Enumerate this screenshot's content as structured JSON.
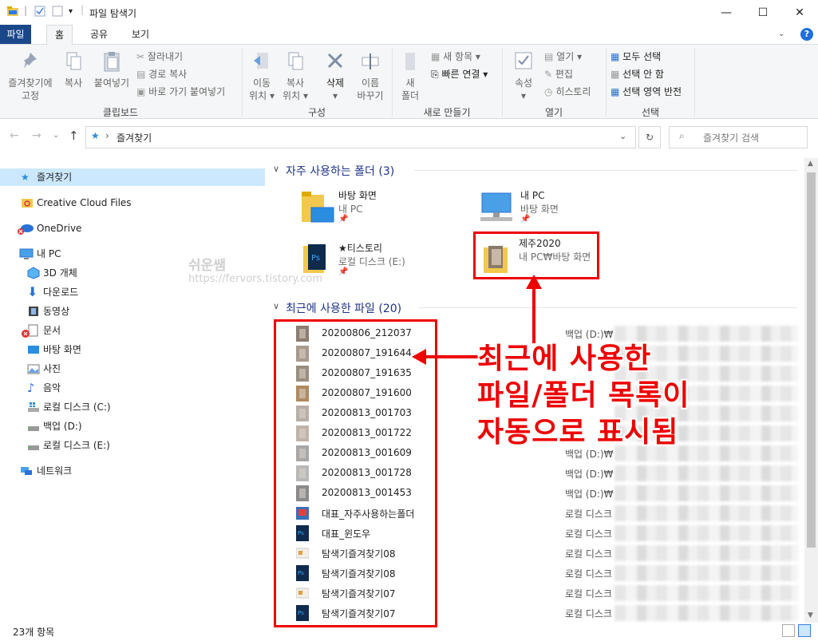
{
  "window": {
    "title": "파일 탐색기",
    "minimize": "—",
    "maximize": "☐",
    "close": "✕"
  },
  "tabs": [
    "파일",
    "홈",
    "공유",
    "보기"
  ],
  "help": "?",
  "ribbon": {
    "clipboard": {
      "label": "클립보드",
      "pin_line1": "즐겨찾기에",
      "pin_line2": "고정",
      "copy": "복사",
      "paste": "붙여넣기",
      "cut": "잘라내기",
      "copy_path": "경로 복사",
      "paste_shortcut": "바로 가기 붙여넣기"
    },
    "organize": {
      "label": "구성",
      "move_line1": "이동",
      "move_line2": "위치",
      "copyto_line1": "복사",
      "copyto_line2": "위치",
      "delete": "삭제",
      "rename_line1": "이름",
      "rename_line2": "바꾸기"
    },
    "new": {
      "label": "새로 만들기",
      "new_folder_line1": "새",
      "new_folder_line2": "폴더",
      "new_item": "새 항목",
      "easy_access": "빠른 연결"
    },
    "open": {
      "label": "열기",
      "properties": "속성",
      "open": "열기",
      "edit": "편집",
      "history": "히스토리"
    },
    "select": {
      "label": "선택",
      "select_all": "모두 선택",
      "select_none": "선택 안 함",
      "invert": "선택 영역 반전"
    }
  },
  "address": {
    "path": "즐겨찾기",
    "search_placeholder": "즐겨찾기 검색"
  },
  "nav": {
    "quick_access": "즐겨찾기",
    "creative_cloud": "Creative Cloud Files",
    "onedrive": "OneDrive",
    "this_pc": "내 PC",
    "objects3d": "3D 개체",
    "downloads": "다운로드",
    "videos": "동영상",
    "documents": "문서",
    "desktop": "바탕 화면",
    "pictures": "사진",
    "music": "음악",
    "drive_c": "로컬 디스크 (C:)",
    "drive_d": "백업 (D:)",
    "drive_e": "로컬 디스크 (E:)",
    "network": "네트워크"
  },
  "frequent": {
    "header": "자주 사용하는 폴더 (3)",
    "items": [
      {
        "name": "바탕 화면",
        "sub": "내 PC"
      },
      {
        "name": "내 PC",
        "sub": "바탕 화면"
      },
      {
        "name": "★티스토리",
        "sub": "로컬 디스크 (E:)"
      },
      {
        "name": "제주2020",
        "sub": "내 PC₩바탕 화면"
      }
    ]
  },
  "recent": {
    "header": "최근에 사용한 파일 (20)",
    "files": [
      {
        "name": "20200806_212037",
        "loc": "백업 (D:)₩"
      },
      {
        "name": "20200807_191644",
        "loc": "백업 (D:)₩"
      },
      {
        "name": "20200807_191635",
        "loc": "백업 (D:)₩"
      },
      {
        "name": "20200807_191600",
        "loc": "백업 (D:)₩"
      },
      {
        "name": "20200813_001703",
        "loc": "백업 (D:)₩"
      },
      {
        "name": "20200813_001722",
        "loc": "백업 (D:)₩"
      },
      {
        "name": "20200813_001609",
        "loc": "백업 (D:)₩★"
      },
      {
        "name": "20200813_001728",
        "loc": "백업 (D:)₩★"
      },
      {
        "name": "20200813_001453",
        "loc": "백업 (D:)₩★"
      },
      {
        "name": "대표_자주사용하는폴더",
        "loc": "로컬 디스크"
      },
      {
        "name": "대표_윈도우",
        "loc": "로컬 디스크"
      },
      {
        "name": "탐색기즐겨찾기08",
        "loc": "로컬 디스크"
      },
      {
        "name": "탐색기즐겨찾기08",
        "loc": "로컬 디스크"
      },
      {
        "name": "탐색기즐겨찾기07",
        "loc": "로컬 디스크"
      },
      {
        "name": "탐색기즐겨찾기07",
        "loc": "로컬 디스크"
      }
    ]
  },
  "status": {
    "count": "23개 항목"
  },
  "annotation": {
    "line1": "최근에 사용한",
    "line2": "파일/폴더 목록이",
    "line3": "자동으로 표시됨"
  },
  "watermark": {
    "name": "쉬운쌤",
    "url": "https://fervors.tistory.com"
  },
  "colors": {
    "accent": "#19478a",
    "annotation_red": "#e00000",
    "section_header": "#1e3287",
    "selected_nav": "#cce8ff"
  }
}
